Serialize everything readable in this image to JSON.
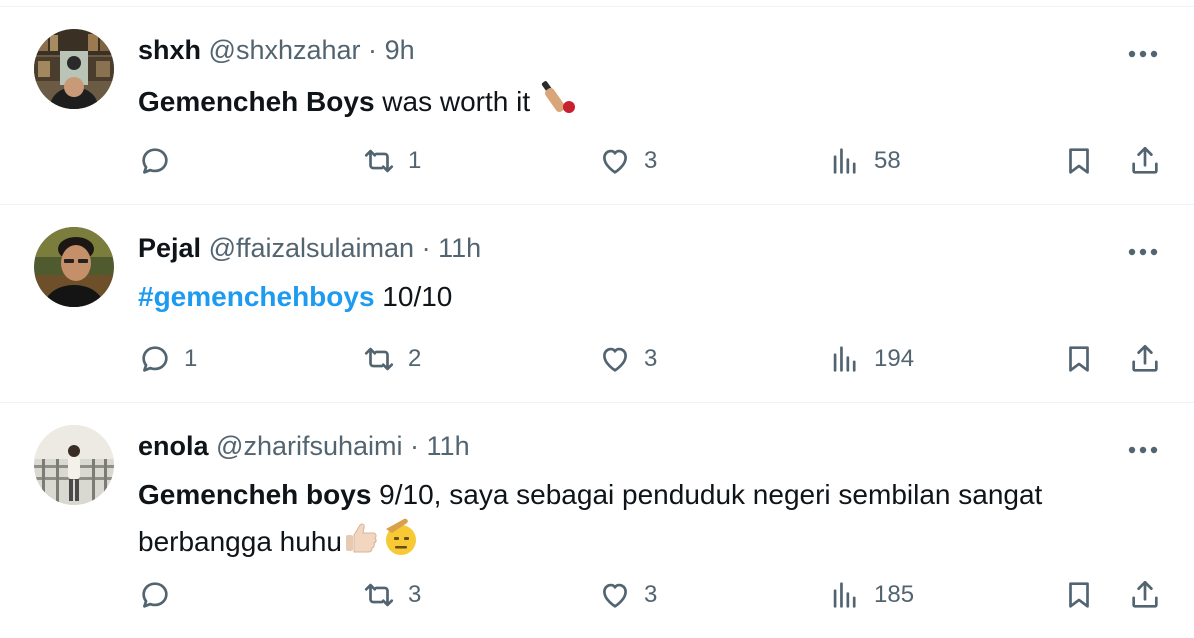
{
  "tweets": [
    {
      "name": "shxh",
      "handle": "@shxhzahar",
      "dot": "·",
      "time": "9h",
      "body_bold": "Gemencheh Boys",
      "body_text": " was worth it ",
      "emoji": "cricket-bat-icon",
      "replies": "",
      "retweets": "1",
      "likes": "3",
      "views": "58"
    },
    {
      "name": "Pejal",
      "handle": "@ffaizalsulaiman",
      "dot": "·",
      "time": "11h",
      "hashtag": "#gemenchehboys",
      "body_text": " 10/10",
      "replies": "1",
      "retweets": "2",
      "likes": "3",
      "views": "194"
    },
    {
      "name": "enola",
      "handle": "@zharifsuhaimi",
      "dot": "·",
      "time": "11h",
      "body_bold": "Gemencheh boys",
      "body_text": " 9/10, saya sebagai penduduk negeri sembilan sangat berbangga huhu",
      "emoji": [
        "thumbs-up-icon",
        "saluting-face-icon"
      ],
      "replies": "",
      "retweets": "3",
      "likes": "3",
      "views": "185"
    }
  ],
  "colors": {
    "text": "#0f1419",
    "secondary": "#536471",
    "link": "#1d9bf0",
    "divider": "#eff3f4"
  }
}
